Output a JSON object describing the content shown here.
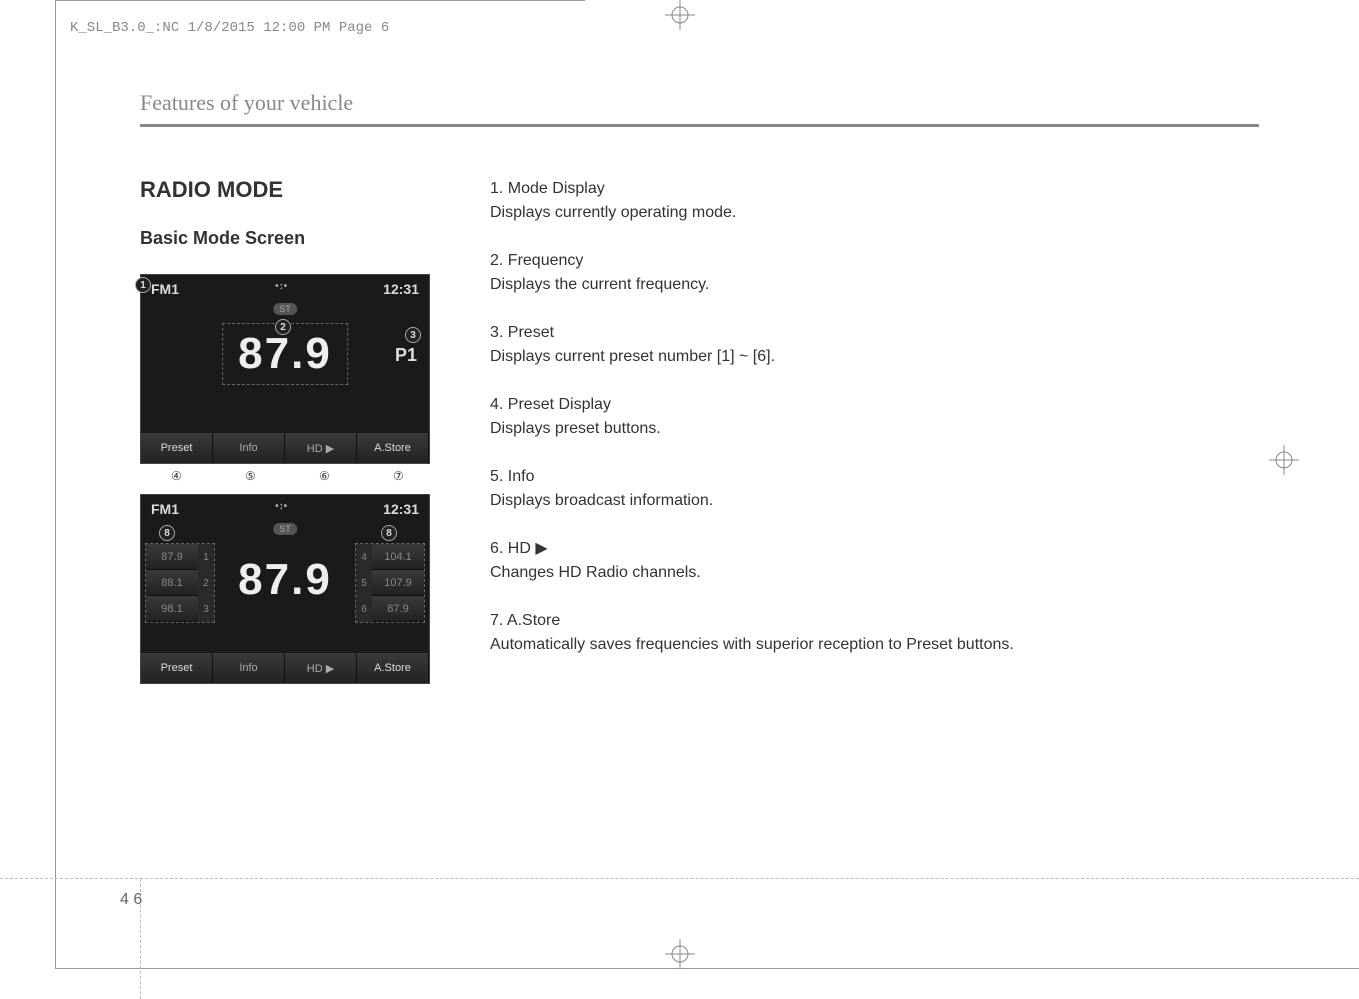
{
  "header": {
    "filename": "K_SL_B3.0_:NC  1/8/2015  12:00 PM  Page 6"
  },
  "section_title": "Features of your vehicle",
  "main_heading": "RADIO MODE",
  "sub_heading": "Basic Mode Screen",
  "screen1": {
    "mode": "FM1",
    "time": "12:31",
    "st_badge": "ST",
    "frequency": "87.9",
    "preset": "P1",
    "buttons": {
      "preset": "Preset",
      "info": "Info",
      "hd": "HD ▶",
      "astore": "A.Store"
    },
    "callouts": {
      "c1": "1",
      "c2": "2",
      "c3": "3",
      "c4": "④",
      "c5": "⑤",
      "c6": "⑥",
      "c7": "⑦"
    }
  },
  "screen2": {
    "mode": "FM1",
    "time": "12:31",
    "st_badge": "ST",
    "frequency": "87.9",
    "presets_left": [
      {
        "freq": "87.9",
        "num": "1"
      },
      {
        "freq": "88.1",
        "num": "2"
      },
      {
        "freq": "98.1",
        "num": "3"
      }
    ],
    "presets_right": [
      {
        "num": "4",
        "freq": "104.1"
      },
      {
        "num": "5",
        "freq": "107.9"
      },
      {
        "num": "6",
        "freq": "87.9"
      }
    ],
    "buttons": {
      "preset": "Preset",
      "info": "Info",
      "hd": "HD ▶",
      "astore": "A.Store"
    },
    "callouts": {
      "left": "8",
      "right": "8"
    }
  },
  "descriptions": [
    {
      "title": "1. Mode Display",
      "body": "Displays currently operating mode."
    },
    {
      "title": "2. Frequency",
      "body": "Displays the current frequency."
    },
    {
      "title": "3. Preset",
      "body": "Displays current preset number [1] ~ [6]."
    },
    {
      "title": "4. Preset Display",
      "body": "Displays preset buttons."
    },
    {
      "title": "5. Info",
      "body": "Displays broadcast information."
    },
    {
      "title": "6. HD ▶",
      "body": "Changes HD Radio channels."
    },
    {
      "title": "7. A.Store",
      "body": "Automatically saves frequencies with superior reception to Preset buttons."
    }
  ],
  "page_number": "4 6"
}
